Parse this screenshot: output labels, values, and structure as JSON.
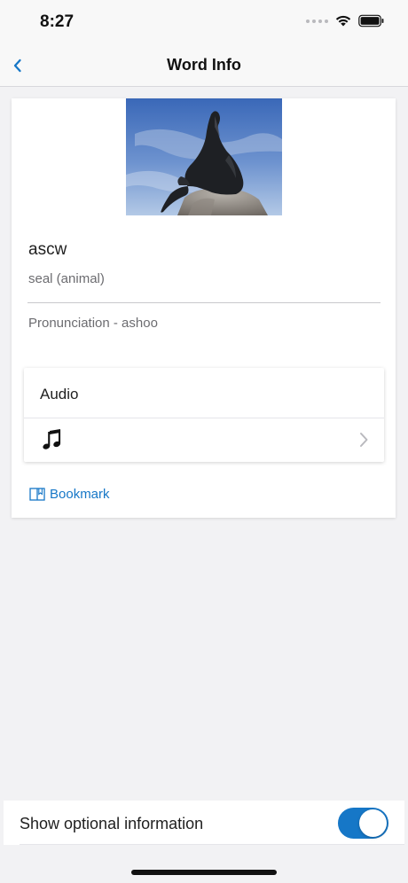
{
  "status_bar": {
    "time": "8:27"
  },
  "navbar": {
    "title": "Word Info",
    "back_icon": "chevron-left-icon"
  },
  "word_card": {
    "image_subject": "sea lion on rock",
    "word": "ascw",
    "meaning": "seal (animal)",
    "pronunciation": "Pronunciation - ashoo"
  },
  "audio_section": {
    "header": "Audio",
    "item_icon": "music-note-icon",
    "chevron_icon": "chevron-right-icon"
  },
  "bookmark": {
    "label": "Bookmark",
    "icon": "book-icon"
  },
  "bottom_bar": {
    "label": "Show optional information",
    "toggle_on": true
  },
  "colors": {
    "accent": "#1677c7",
    "background": "#f2f2f4",
    "card": "#ffffff",
    "secondary_text": "#6c6c70"
  }
}
